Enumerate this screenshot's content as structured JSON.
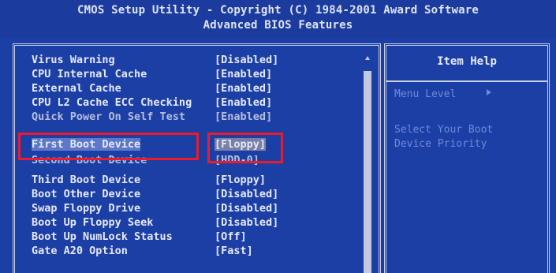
{
  "header": {
    "title_line": "CMOS Setup Utility - Copyright (C) 1984-2001 Award Software",
    "subtitle_line": "Advanced BIOS Features"
  },
  "settings": [
    {
      "label": "Virus Warning",
      "value": "[Disabled]"
    },
    {
      "label": "CPU Internal Cache",
      "value": "[Enabled]"
    },
    {
      "label": "External Cache",
      "value": "[Enabled]"
    },
    {
      "label": "CPU L2 Cache ECC Checking",
      "value": "[Enabled]"
    },
    {
      "label": "Quick Power On Self Test",
      "value": "[Enabled]"
    },
    {
      "label": "First Boot Device",
      "value": "[Floppy]"
    },
    {
      "label": "Second Boot Device",
      "value": "[HDD-0]"
    },
    {
      "label": "Third Boot Device",
      "value": "[Floppy]"
    },
    {
      "label": "Boot Other Device",
      "value": "[Disabled]"
    },
    {
      "label": "Swap Floppy Drive",
      "value": "[Disabled]"
    },
    {
      "label": "Boot Up Floppy Seek",
      "value": "[Disabled]"
    },
    {
      "label": "Boot Up NumLock Status",
      "value": "[Off]"
    },
    {
      "label": "Gate A20 Option",
      "value": "[Fast]"
    }
  ],
  "help": {
    "title": "Item Help",
    "menu_level": "Menu Level",
    "description_line1": "Select Your Boot",
    "description_line2": "Device Priority"
  },
  "colors": {
    "bios_background": "#1c3fa6",
    "text": "#e6e9f5",
    "help_text": "#6f8ad9",
    "annotation_red": "#ea1c2c"
  }
}
